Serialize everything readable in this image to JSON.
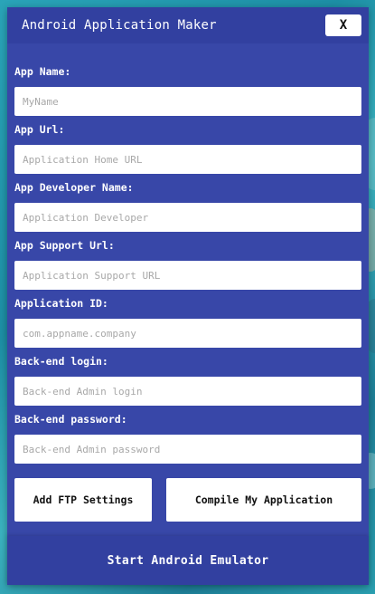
{
  "window": {
    "title": "Android Application Maker",
    "close_label": "X"
  },
  "form": {
    "fields": [
      {
        "label": "App Name:",
        "placeholder": "MyName",
        "value": ""
      },
      {
        "label": "App Url:",
        "placeholder": "Application Home URL",
        "value": ""
      },
      {
        "label": "App Developer Name:",
        "placeholder": "Application Developer",
        "value": ""
      },
      {
        "label": "App Support Url:",
        "placeholder": "Application Support URL",
        "value": ""
      },
      {
        "label": "Application ID:",
        "placeholder": "com.appname.company",
        "value": ""
      },
      {
        "label": "Back-end login:",
        "placeholder": "Back-end Admin login",
        "value": ""
      },
      {
        "label": "Back-end password:",
        "placeholder": "Back-end Admin password",
        "value": ""
      }
    ]
  },
  "actions": {
    "ftp_label": "Add FTP Settings",
    "compile_label": "Compile My Application",
    "emulator_label": "Start Android Emulator"
  },
  "colors": {
    "panel": "#3847a8",
    "titlebar": "#3240a0",
    "button_bg": "#ffffff",
    "text_light": "#ffffff"
  }
}
